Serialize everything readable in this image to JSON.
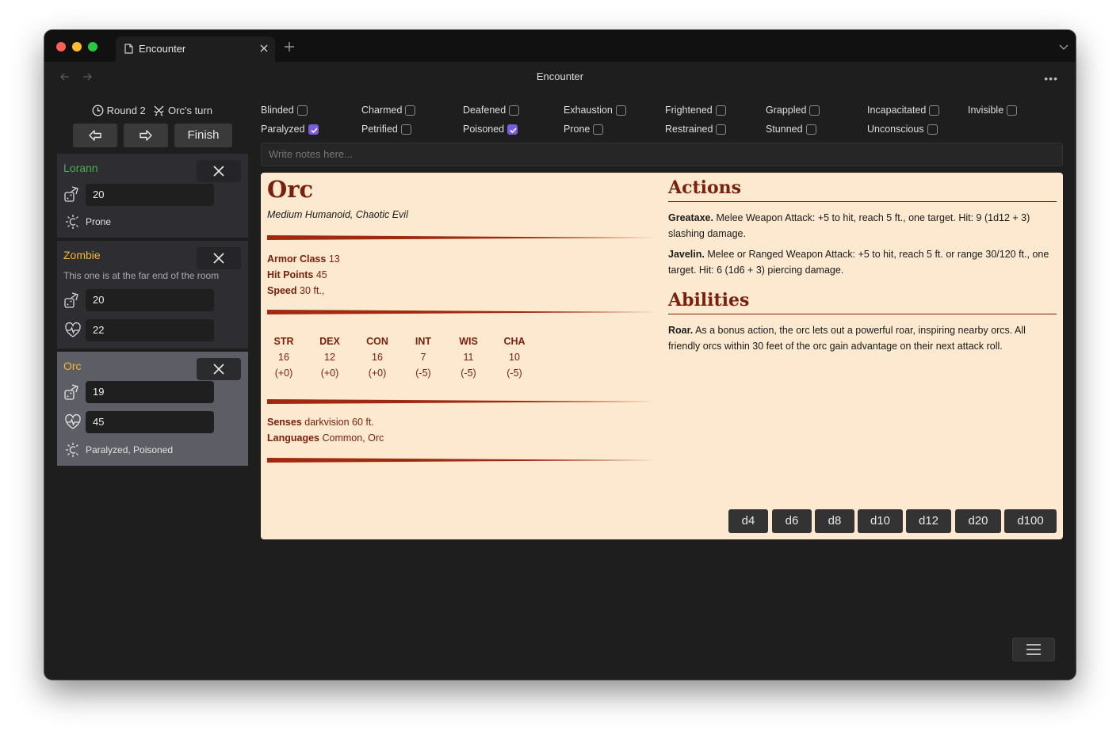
{
  "browser": {
    "tab_title": "Encounter",
    "window_title": "Encounter"
  },
  "tracker": {
    "round_label": "Round 2",
    "turn_label": "Orc's turn",
    "finish_label": "Finish"
  },
  "combatants": [
    {
      "name": "Lorann",
      "name_color": "#4caf50",
      "initiative": "20",
      "conditions": "Prone"
    },
    {
      "name": "Zombie",
      "name_color": "#f5b82e",
      "note": "This one is at the far end of the room",
      "initiative": "20",
      "hp": "22"
    },
    {
      "name": "Orc",
      "name_color": "#f5b82e",
      "initiative": "19",
      "hp": "45",
      "conditions": "Paralyzed, Poisoned"
    }
  ],
  "conditions": [
    {
      "label": "Blinded",
      "checked": false
    },
    {
      "label": "Charmed",
      "checked": false
    },
    {
      "label": "Deafened",
      "checked": false
    },
    {
      "label": "Exhaustion",
      "checked": false
    },
    {
      "label": "Frightened",
      "checked": false
    },
    {
      "label": "Grappled",
      "checked": false
    },
    {
      "label": "Incapacitated",
      "checked": false
    },
    {
      "label": "Invisible",
      "checked": false
    },
    {
      "label": "Paralyzed",
      "checked": true
    },
    {
      "label": "Petrified",
      "checked": false
    },
    {
      "label": "Poisoned",
      "checked": true
    },
    {
      "label": "Prone",
      "checked": false
    },
    {
      "label": "Restrained",
      "checked": false
    },
    {
      "label": "Stunned",
      "checked": false
    },
    {
      "label": "Unconscious",
      "checked": false
    }
  ],
  "notes": {
    "placeholder": "Write notes here..."
  },
  "monster": {
    "name": "Orc",
    "type": "Medium Humanoid, Chaotic Evil",
    "armor_class_label": "Armor Class",
    "armor_class": "13",
    "hit_points_label": "Hit Points",
    "hit_points": "45",
    "speed_label": "Speed",
    "speed": "30 ft.,",
    "abilities": [
      {
        "name": "STR",
        "score": "16",
        "mod": "(+0)"
      },
      {
        "name": "DEX",
        "score": "12",
        "mod": "(+0)"
      },
      {
        "name": "CON",
        "score": "16",
        "mod": "(+0)"
      },
      {
        "name": "INT",
        "score": "7",
        "mod": "(-5)"
      },
      {
        "name": "WIS",
        "score": "11",
        "mod": "(-5)"
      },
      {
        "name": "CHA",
        "score": "10",
        "mod": "(-5)"
      }
    ],
    "senses_label": "Senses",
    "senses": "darkvision 60 ft.",
    "languages_label": "Languages",
    "languages": "Common, Orc",
    "actions_title": "Actions",
    "actions": [
      {
        "name": "Greataxe.",
        "text": "Melee Weapon Attack: +5 to hit, reach 5 ft., one target. Hit: 9 (1d12 + 3) slashing damage."
      },
      {
        "name": "Javelin.",
        "text": "Melee or Ranged Weapon Attack: +5 to hit, reach 5 ft. or range 30/120 ft., one target. Hit: 6 (1d6 + 3) piercing damage."
      }
    ],
    "abilities_title": "Abilities",
    "traits": [
      {
        "name": "Roar.",
        "text": "As a bonus action, the orc lets out a powerful roar, inspiring nearby orcs. All friendly orcs within 30 feet of the orc gain advantage on their next attack roll."
      }
    ]
  },
  "dice": [
    "d4",
    "d6",
    "d8",
    "d10",
    "d12",
    "d20",
    "d100"
  ],
  "colors": {
    "accent": "#7b5ce0",
    "statblock_bg": "#fce9cf",
    "statblock_text": "#7a200d",
    "window_bg": "#1e1e1e"
  }
}
